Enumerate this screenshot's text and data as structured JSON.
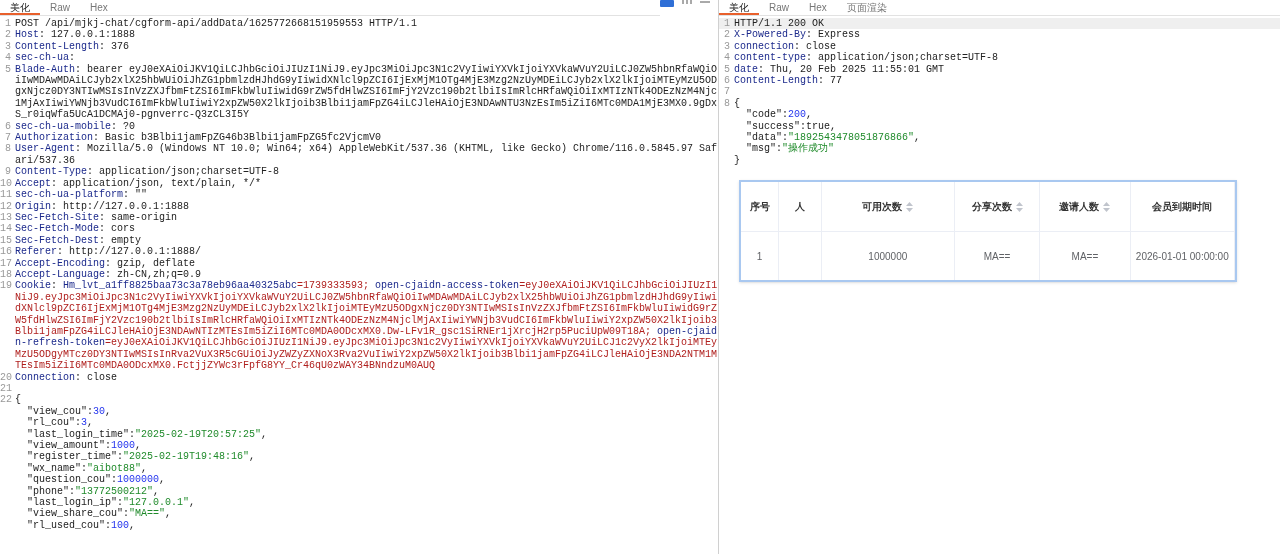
{
  "request": {
    "tabs": [
      {
        "label": "美化",
        "selected": true
      },
      {
        "label": "Raw",
        "selected": false
      },
      {
        "label": "Hex",
        "selected": false
      }
    ],
    "lines": [
      {
        "number": "1",
        "segments": [
          {
            "kind": "text",
            "text": "POST /api/mjkj-chat/cgform-api/addData/1625772668151959553 HTTP/1.1"
          }
        ]
      },
      {
        "number": "2",
        "segments": [
          {
            "kind": "name",
            "text": "Host"
          },
          {
            "kind": "text",
            "text": ": 127.0.0.1:1888"
          }
        ]
      },
      {
        "number": "3",
        "segments": [
          {
            "kind": "name",
            "text": "Content-Length"
          },
          {
            "kind": "text",
            "text": ": 376"
          }
        ]
      },
      {
        "number": "4",
        "segments": [
          {
            "kind": "name",
            "text": "sec-ch-ua"
          },
          {
            "kind": "text",
            "text": ":"
          }
        ]
      },
      {
        "number": "5",
        "segments": [
          {
            "kind": "name",
            "text": "Blade-Auth"
          },
          {
            "kind": "text",
            "text": ": bearer eyJ0eXAiOiJKV1QiLCJhbGciOiJIUzI1NiJ9.eyJpc3MiOiJpc3N1c2VyIiwiYXVkIjoiYXVkaWVuY2UiLCJ0ZW5hbnRfaWQiOiIwMDAwMDAiLCJyb2xlX25hbWUiOiJhZG1pbmlzdHJhdG9yIiwidXNlcl9pZCI6IjExMjM1OTg4MjE3Mzg2NzUyMDEiLCJyb2xlX2lkIjoiMTEyMzU5ODgxNjcz0DY3NTIwMSIsInVzZXJfbmFtZSI6ImFkbWluIiwidG9rZW5fdHlwZSI6ImFjY2Vzc190b2tlbiIsImRlcHRfaWQiOiIxMTIzNTk4ODEzNzM4Njc1MjAxIiwiYWNjb3VudCI6ImFkbWluIiwiY2xpZW50X2lkIjoib3Blbi1jamFpZG4iLCJleHAiOjE3NDAwNTU3NzEsIm5iZiI6MTc0MDA1MjE3MX0.9gDxS_r0iqWfa5UcA1DCMAj0-pgnverrc-Q3zCL3I5Y"
          }
        ]
      },
      {
        "number": "6",
        "segments": [
          {
            "kind": "name",
            "text": "sec-ch-ua-mobile"
          },
          {
            "kind": "text",
            "text": ": ?0"
          }
        ]
      },
      {
        "number": "7",
        "segments": [
          {
            "kind": "name",
            "text": "Authorization"
          },
          {
            "kind": "text",
            "text": ": Basic b3Blbi1jamFpZG46b3Blbi1jamFpZG5fc2VjcmV0"
          }
        ]
      },
      {
        "number": "8",
        "segments": [
          {
            "kind": "name",
            "text": "User-Agent"
          },
          {
            "kind": "text",
            "text": ": Mozilla/5.0 (Windows NT 10.0; Win64; x64) AppleWebKit/537.36 (KHTML, like Gecko) Chrome/116.0.5845.97 Safari/537.36"
          }
        ]
      },
      {
        "number": "9",
        "segments": [
          {
            "kind": "name",
            "text": "Content-Type"
          },
          {
            "kind": "text",
            "text": ": application/json;charset=UTF-8"
          }
        ]
      },
      {
        "number": "10",
        "segments": [
          {
            "kind": "name",
            "text": "Accept"
          },
          {
            "kind": "text",
            "text": ": application/json, text/plain, */*"
          }
        ]
      },
      {
        "number": "11",
        "segments": [
          {
            "kind": "name",
            "text": "sec-ch-ua-platform"
          },
          {
            "kind": "text",
            "text": ": \"\""
          }
        ]
      },
      {
        "number": "12",
        "segments": [
          {
            "kind": "name",
            "text": "Origin"
          },
          {
            "kind": "text",
            "text": ": http://127.0.0.1:1888"
          }
        ]
      },
      {
        "number": "13",
        "segments": [
          {
            "kind": "name",
            "text": "Sec-Fetch-Site"
          },
          {
            "kind": "text",
            "text": ": same-origin"
          }
        ]
      },
      {
        "number": "14",
        "segments": [
          {
            "kind": "name",
            "text": "Sec-Fetch-Mode"
          },
          {
            "kind": "text",
            "text": ": cors"
          }
        ]
      },
      {
        "number": "15",
        "segments": [
          {
            "kind": "name",
            "text": "Sec-Fetch-Dest"
          },
          {
            "kind": "text",
            "text": ": empty"
          }
        ]
      },
      {
        "number": "16",
        "segments": [
          {
            "kind": "name",
            "text": "Referer"
          },
          {
            "kind": "text",
            "text": ": http://127.0.0.1:1888/"
          }
        ]
      },
      {
        "number": "17",
        "segments": [
          {
            "kind": "name",
            "text": "Accept-Encoding"
          },
          {
            "kind": "text",
            "text": ": gzip, deflate"
          }
        ]
      },
      {
        "number": "18",
        "segments": [
          {
            "kind": "name",
            "text": "Accept-Language"
          },
          {
            "kind": "text",
            "text": ": zh-CN,zh;q=0.9"
          }
        ]
      },
      {
        "number": "19",
        "segments": [
          {
            "kind": "name",
            "text": "Cookie"
          },
          {
            "kind": "text",
            "text": ": "
          },
          {
            "kind": "name",
            "text": "Hm_lvt_a1ff8825baa73c3a78eb96aa40325abc"
          },
          {
            "kind": "cookie",
            "text": "=1739333593; "
          },
          {
            "kind": "name",
            "text": "open-cjaidn-access-token"
          },
          {
            "kind": "cookie",
            "text": "=eyJ0eXAiOiJKV1QiLCJhbGciOiJIUzI1NiJ9.eyJpc3MiOiJpc3N1c2VyIiwiYXVkIjoiYXVkaWVuY2UiLCJ0ZW5hbnRfaWQiOiIwMDAwMDAiLCJyb2xlX25hbWUiOiJhZG1pbmlzdHJhdG9yIiwidXNlcl9pZCI6IjExMjM1OTg4MjE3Mzg2NzUyMDEiLCJyb2xlX2lkIjoiMTEyMzU5ODgxNjcz0DY3NTIwMSIsInVzZXJfbmFtZSI6ImFkbWluIiwidG9rZW5fdHlwZSI6ImFjY2Vzc190b2tlbiIsImRlcHRfaWQiOiIxMTIzNTk4ODEzNzM4NjclMjAxIiwiYWNjb3VudCI6ImFkbWluIiwiY2xpZW50X2lkIjoib3Blbi1jamFpZG4iLCJleHAiOjE3NDAwNTIzMTEsIm5iZiI6MTc0MDA0ODcxMX0.Dw-LFv1R_gsc1SiRNEr1jXrcjH2rp5PuciUpW09T18A; "
          },
          {
            "kind": "name",
            "text": "open-cjaidn-refresh-token"
          },
          {
            "kind": "cookie",
            "text": "=eyJ0eXAiOiJKV1QiLCJhbGciOiJIUzI1NiJ9.eyJpc3MiOiJpc3N1c2VyIiwiYXVkIjoiYXVkaWVuY2UiLCJ1c2VyX2lkIjoiMTEyMzU5ODgyMTcz0DY3NTIwMSIsInRva2VuX3R5cGUiOiJyZWZyZXNoX3Rva2VuIiwiY2xpZW50X2lkIjoib3Blbi1jamFpZG4iLCJleHAiOjE3NDA2NTM1MTEsIm5iZiI6MTc0MDA0ODcxMX0.FctjjZYWc3rFpfG8YY_Cr46qU0zWAY34BNndzuM0AUQ"
          }
        ]
      },
      {
        "number": "20",
        "segments": [
          {
            "kind": "name",
            "text": "Connection"
          },
          {
            "kind": "text",
            "text": ": close"
          }
        ]
      },
      {
        "number": "21"
      },
      {
        "number": "22",
        "segments": [
          {
            "kind": "text",
            "text": "{"
          }
        ]
      },
      {
        "segments": [
          {
            "kind": "key",
            "text": "  \"view_cou\":"
          },
          {
            "kind": "num",
            "text": "30"
          },
          {
            "kind": "text",
            "text": ","
          }
        ]
      },
      {
        "segments": [
          {
            "kind": "key",
            "text": "  \"rl_cou\":"
          },
          {
            "kind": "num",
            "text": "3"
          },
          {
            "kind": "text",
            "text": ","
          }
        ]
      },
      {
        "segments": [
          {
            "kind": "key",
            "text": "  \"last_login_time\":"
          },
          {
            "kind": "str",
            "text": "\"2025-02-19T20:57:25\""
          },
          {
            "kind": "text",
            "text": ","
          }
        ]
      },
      {
        "segments": [
          {
            "kind": "key",
            "text": "  \"view_amount\":"
          },
          {
            "kind": "num",
            "text": "1000"
          },
          {
            "kind": "text",
            "text": ","
          }
        ]
      },
      {
        "segments": [
          {
            "kind": "key",
            "text": "  \"register_time\":"
          },
          {
            "kind": "str",
            "text": "\"2025-02-19T19:48:16\""
          },
          {
            "kind": "text",
            "text": ","
          }
        ]
      },
      {
        "segments": [
          {
            "kind": "key",
            "text": "  \"wx_name\":"
          },
          {
            "kind": "str",
            "text": "\"aibot88\""
          },
          {
            "kind": "text",
            "text": ","
          }
        ]
      },
      {
        "segments": [
          {
            "kind": "key",
            "text": "  \"question_cou\":"
          },
          {
            "kind": "num",
            "text": "1000000"
          },
          {
            "kind": "text",
            "text": ","
          }
        ]
      },
      {
        "segments": [
          {
            "kind": "key",
            "text": "  \"phone\":"
          },
          {
            "kind": "str",
            "text": "\"13772500212\""
          },
          {
            "kind": "text",
            "text": ","
          }
        ]
      },
      {
        "segments": [
          {
            "kind": "key",
            "text": "  \"last_login_ip\":"
          },
          {
            "kind": "str",
            "text": "\"127.0.0.1\""
          },
          {
            "kind": "text",
            "text": ","
          }
        ]
      },
      {
        "segments": [
          {
            "kind": "key",
            "text": "  \"view_share_cou\":"
          },
          {
            "kind": "str",
            "text": "\"MA==\""
          },
          {
            "kind": "text",
            "text": ","
          }
        ]
      },
      {
        "segments": [
          {
            "kind": "key",
            "text": "  \"rl_used_cou\":"
          },
          {
            "kind": "num",
            "text": "100"
          },
          {
            "kind": "text",
            "text": ","
          }
        ]
      }
    ]
  },
  "response": {
    "tabs": [
      {
        "label": "美化",
        "selected": true
      },
      {
        "label": "Raw",
        "selected": false
      },
      {
        "label": "Hex",
        "selected": false
      },
      {
        "label": "页面渲染",
        "selected": false
      }
    ],
    "lines": [
      {
        "number": "1",
        "highlighted": true,
        "segments": [
          {
            "kind": "text",
            "text": "HTTP/1.1 200 OK"
          }
        ]
      },
      {
        "number": "2",
        "highlighted": false,
        "segments": [
          {
            "kind": "name",
            "text": "X-Powered-By"
          },
          {
            "kind": "text",
            "text": ": Express"
          }
        ]
      },
      {
        "number": "3",
        "highlighted": false,
        "segments": [
          {
            "kind": "name",
            "text": "connection"
          },
          {
            "kind": "text",
            "text": ": close"
          }
        ]
      },
      {
        "number": "4",
        "highlighted": false,
        "segments": [
          {
            "kind": "name",
            "text": "content-type"
          },
          {
            "kind": "text",
            "text": ": application/json;charset=UTF-8"
          }
        ]
      },
      {
        "number": "5",
        "highlighted": false,
        "segments": [
          {
            "kind": "name",
            "text": "date"
          },
          {
            "kind": "text",
            "text": ": Thu, 20 Feb 2025 11:55:01 GMT"
          }
        ]
      },
      {
        "number": "6",
        "highlighted": false,
        "segments": [
          {
            "kind": "name",
            "text": "Content-Length"
          },
          {
            "kind": "text",
            "text": ": 77"
          }
        ]
      },
      {
        "number": "7",
        "highlighted": false
      },
      {
        "number": "8",
        "highlighted": false,
        "segments": [
          {
            "kind": "text",
            "text": "{"
          }
        ]
      },
      {
        "highlighted": false,
        "segments": [
          {
            "kind": "key",
            "text": "  \"code\":"
          },
          {
            "kind": "num",
            "text": "200"
          },
          {
            "kind": "text",
            "text": ","
          }
        ]
      },
      {
        "highlighted": false,
        "segments": [
          {
            "kind": "key",
            "text": "  \"success\":true,"
          }
        ]
      },
      {
        "highlighted": false,
        "segments": [
          {
            "kind": "key",
            "text": "  \"data\":"
          },
          {
            "kind": "str",
            "text": "\"1892543478051876866\""
          },
          {
            "kind": "text",
            "text": ","
          }
        ]
      },
      {
        "highlighted": false,
        "segments": [
          {
            "kind": "key",
            "text": "  \"msg\":"
          },
          {
            "kind": "str",
            "text": "\"操作成功\""
          }
        ]
      },
      {
        "highlighted": false,
        "segments": [
          {
            "kind": "text",
            "text": "}"
          }
        ]
      }
    ]
  },
  "table": {
    "columns": [
      {
        "label": "序号",
        "sortable": false
      },
      {
        "label": "人",
        "sortable": false
      },
      {
        "label": "可用次数",
        "sortable": true
      },
      {
        "label": "分享次数",
        "sortable": true
      },
      {
        "label": "邀请人数",
        "sortable": true
      },
      {
        "label": "会员到期时间",
        "sortable": false
      }
    ],
    "rows": [
      [
        "1",
        "",
        "1000000",
        "MA==",
        "MA==",
        "2026-01-01 00:00:00"
      ]
    ]
  }
}
